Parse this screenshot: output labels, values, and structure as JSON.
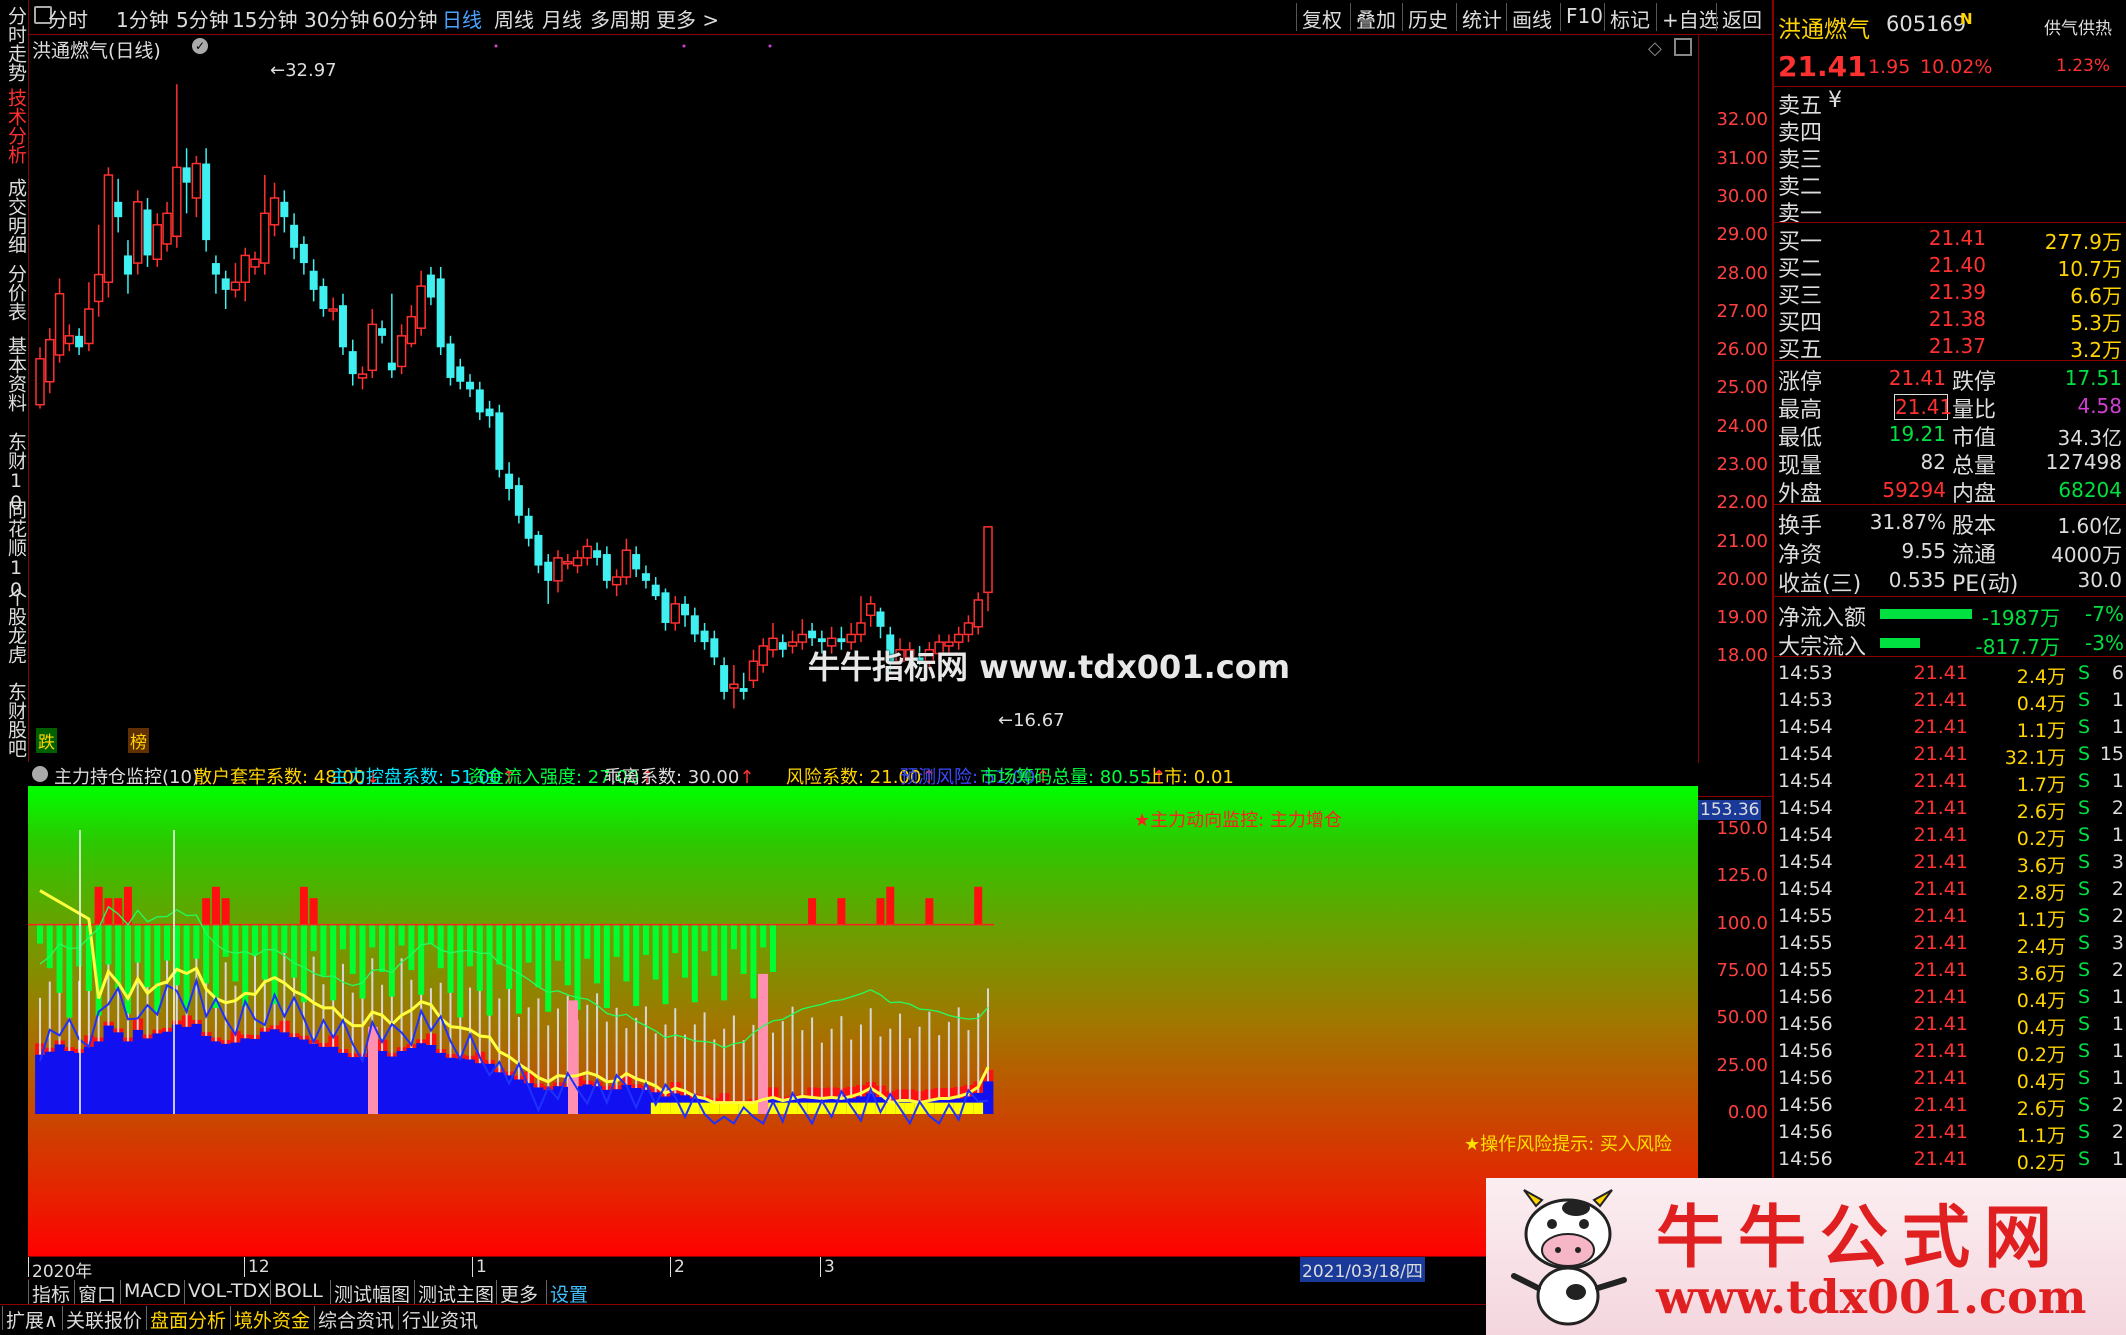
{
  "toolbar": {
    "periods": [
      "分时",
      "1分钟",
      "5分钟",
      "15分钟",
      "30分钟",
      "60分钟",
      "日线",
      "周线",
      "月线",
      "多周期",
      "更多 >"
    ],
    "selected": "日线",
    "right_buttons": [
      "复权",
      "叠加",
      "历史",
      "统计",
      "画线",
      "F10",
      "标记",
      "+自选",
      "返回"
    ]
  },
  "left_tabs": [
    "分时走势",
    "技术分析",
    "成交明细",
    "分价表",
    "基本资料",
    "东财10",
    "同花顺10",
    "个股龙虎",
    "东财股吧"
  ],
  "chart_title": "洪通燃气(日线)",
  "high_label": "32.97",
  "low_label": "16.67",
  "markers": {
    "die": "跌",
    "bang": "榜"
  },
  "y_axis_main": [
    "32.00",
    "31.00",
    "30.00",
    "29.00",
    "28.00",
    "27.00",
    "26.00",
    "25.00",
    "24.00",
    "23.00",
    "22.00",
    "21.00",
    "20.00",
    "19.00",
    "18.00"
  ],
  "y_axis_ind": [
    "150.0",
    "125.0",
    "100.0",
    "75.00",
    "50.00",
    "25.00",
    "0.00"
  ],
  "ind_top_value": "153.36",
  "indicator": {
    "name": "主力持仓监控(10)",
    "items": [
      {
        "text": "散户套牢系数: 48.00",
        "arrow": "↓",
        "color": "#ffd400"
      },
      {
        "text": "主力控盘系数: 51.00",
        "arrow": "↑",
        "color": "#00e5ff"
      },
      {
        "text": "资金流入强度: 27.00",
        "arrow": "↑",
        "color": "#00ff40"
      },
      {
        "text": "乖离系数: 30.00",
        "arrow": "↑",
        "color": "#dddddd"
      },
      {
        "text": "风险系数: 21.00",
        "arrow": "↑",
        "color": "#ffd400"
      },
      {
        "text": "预测风险: 51.00",
        "arrow": "↑",
        "color": "#3a4cff"
      },
      {
        "text": "市场筹码总量: 80.55",
        "arrow": "↑",
        "color": "#00ff40"
      },
      {
        "text": "上市: 0.01",
        "arrow": "",
        "color": "#ffd400"
      }
    ],
    "monitor_text": "★主力动向监控: 主力增仓",
    "risk_text": "★操作风险提示: 买入风险"
  },
  "time_axis": {
    "labels": [
      "2020年",
      "12",
      "1",
      "2",
      "3"
    ],
    "current": "2021/03/18/四"
  },
  "bottom_tabs": [
    "指标",
    "窗口",
    "MACD",
    "VOL-TDX",
    "BOLL",
    "测试幅图",
    "测试主图",
    "更多",
    "设置"
  ],
  "bottom_tabs2": [
    "扩展∧",
    "关联报价",
    "盘面分析",
    "境外资金",
    "综合资讯",
    "行业资讯"
  ],
  "watermark_center": "牛牛指标网 www.tdx001.com",
  "watermark_logo_title": "牛牛公式网",
  "watermark_logo_url": "www.tdx001.com",
  "quote": {
    "name": "洪通燃气",
    "code": "605169",
    "tag": "N",
    "sector": "供气供热",
    "price": "21.41",
    "change": "1.95",
    "pct": "10.02%",
    "sector_pct": "1.23%",
    "sell_labels": [
      "卖五",
      "卖四",
      "卖三",
      "卖二",
      "卖一"
    ],
    "sell_extra": "¥",
    "buy": [
      {
        "label": "买一",
        "price": "21.41",
        "vol": "277.9万"
      },
      {
        "label": "买二",
        "price": "21.40",
        "vol": "10.7万"
      },
      {
        "label": "买三",
        "price": "21.39",
        "vol": "6.6万"
      },
      {
        "label": "买四",
        "price": "21.38",
        "vol": "5.3万"
      },
      {
        "label": "买五",
        "price": "21.37",
        "vol": "3.2万"
      }
    ],
    "stats": [
      {
        "l": "涨停",
        "v": "21.41",
        "vc": "#ff3030",
        "l2": "跌停",
        "v2": "17.51",
        "v2c": "#00e040"
      },
      {
        "l": "最高",
        "v": "21.41",
        "vc": "#ff3030",
        "l2": "量比",
        "v2": "4.58",
        "v2c": "#d040d0"
      },
      {
        "l": "最低",
        "v": "19.21",
        "vc": "#00e040",
        "l2": "市值",
        "v2": "34.3亿",
        "v2c": "#dddddd"
      },
      {
        "l": "现量",
        "v": "82",
        "vc": "#dddddd",
        "l2": "总量",
        "v2": "127498",
        "v2c": "#dddddd"
      },
      {
        "l": "外盘",
        "v": "59294",
        "vc": "#ff3030",
        "l2": "内盘",
        "v2": "68204",
        "v2c": "#00e040"
      }
    ],
    "stats2": [
      {
        "l": "换手",
        "v": "31.87%",
        "l2": "股本",
        "v2": "1.60亿"
      },
      {
        "l": "净资",
        "v": "9.55",
        "l2": "流通",
        "v2": "4000万"
      },
      {
        "l": "收益(三)",
        "v": "0.535",
        "l2": "PE(动)",
        "v2": "30.0"
      }
    ],
    "flows": [
      {
        "l": "净流入额",
        "v": "-1987万",
        "p": "-7%"
      },
      {
        "l": "大宗流入",
        "v": "-817.7万",
        "p": "-3%"
      }
    ],
    "ticks": [
      [
        "14:53",
        "21.41",
        "2.4万",
        "S",
        "6"
      ],
      [
        "14:53",
        "21.41",
        "0.4万",
        "S",
        "1"
      ],
      [
        "14:54",
        "21.41",
        "1.1万",
        "S",
        "1"
      ],
      [
        "14:54",
        "21.41",
        "32.1万",
        "S",
        "15"
      ],
      [
        "14:54",
        "21.41",
        "1.7万",
        "S",
        "1"
      ],
      [
        "14:54",
        "21.41",
        "2.6万",
        "S",
        "2"
      ],
      [
        "14:54",
        "21.41",
        "0.2万",
        "S",
        "1"
      ],
      [
        "14:54",
        "21.41",
        "3.6万",
        "S",
        "3"
      ],
      [
        "14:54",
        "21.41",
        "2.8万",
        "S",
        "2"
      ],
      [
        "14:55",
        "21.41",
        "1.1万",
        "S",
        "2"
      ],
      [
        "14:55",
        "21.41",
        "2.4万",
        "S",
        "3"
      ],
      [
        "14:55",
        "21.41",
        "3.6万",
        "S",
        "2"
      ],
      [
        "14:56",
        "21.41",
        "0.4万",
        "S",
        "1"
      ],
      [
        "14:56",
        "21.41",
        "0.4万",
        "S",
        "1"
      ],
      [
        "14:56",
        "21.41",
        "0.2万",
        "S",
        "1"
      ],
      [
        "14:56",
        "21.41",
        "0.4万",
        "S",
        "1"
      ],
      [
        "14:56",
        "21.41",
        "2.6万",
        "S",
        "2"
      ],
      [
        "14:56",
        "21.41",
        "1.1万",
        "S",
        "2"
      ],
      [
        "14:56",
        "21.41",
        "0.2万",
        "S",
        "1"
      ]
    ]
  },
  "chart_data": {
    "type": "candlestick",
    "ylim": [
      16.0,
      33.5
    ],
    "candles": [
      {
        "o": 24.6,
        "c": 25.8,
        "h": 26.1,
        "l": 24.5
      },
      {
        "o": 25.2,
        "c": 26.3,
        "h": 26.6,
        "l": 24.9
      },
      {
        "o": 25.9,
        "c": 27.5,
        "h": 27.9,
        "l": 25.7
      },
      {
        "o": 26.2,
        "c": 26.4,
        "h": 26.7,
        "l": 26.0
      },
      {
        "o": 26.4,
        "c": 26.1,
        "h": 26.6,
        "l": 25.9
      },
      {
        "o": 26.2,
        "c": 27.1,
        "h": 27.8,
        "l": 26.0
      },
      {
        "o": 27.3,
        "c": 28.0,
        "h": 29.3,
        "l": 26.9
      },
      {
        "o": 27.8,
        "c": 30.6,
        "h": 30.8,
        "l": 27.4
      },
      {
        "o": 29.9,
        "c": 29.5,
        "h": 30.5,
        "l": 29.1
      },
      {
        "o": 28.5,
        "c": 28.0,
        "h": 28.9,
        "l": 27.5
      },
      {
        "o": 28.3,
        "c": 29.9,
        "h": 30.2,
        "l": 28.0
      },
      {
        "o": 29.7,
        "c": 28.5,
        "h": 30.0,
        "l": 28.2
      },
      {
        "o": 28.4,
        "c": 29.3,
        "h": 29.6,
        "l": 28.2
      },
      {
        "o": 28.8,
        "c": 29.6,
        "h": 29.9,
        "l": 28.6
      },
      {
        "o": 29.0,
        "c": 30.8,
        "h": 32.97,
        "l": 28.7
      },
      {
        "o": 30.8,
        "c": 30.4,
        "h": 31.3,
        "l": 29.6
      },
      {
        "o": 30.0,
        "c": 30.9,
        "h": 31.1,
        "l": 29.5
      },
      {
        "o": 30.9,
        "c": 28.9,
        "h": 31.3,
        "l": 28.6
      },
      {
        "o": 28.3,
        "c": 28.0,
        "h": 28.5,
        "l": 27.5
      },
      {
        "o": 27.9,
        "c": 27.6,
        "h": 28.1,
        "l": 27.1
      },
      {
        "o": 27.6,
        "c": 27.8,
        "h": 28.3,
        "l": 27.4
      },
      {
        "o": 27.8,
        "c": 28.5,
        "h": 28.7,
        "l": 27.3
      },
      {
        "o": 28.2,
        "c": 28.4,
        "h": 28.6,
        "l": 28.0
      },
      {
        "o": 28.3,
        "c": 29.6,
        "h": 30.6,
        "l": 28.0
      },
      {
        "o": 29.3,
        "c": 30.0,
        "h": 30.4,
        "l": 29.0
      },
      {
        "o": 29.9,
        "c": 29.5,
        "h": 30.2,
        "l": 29.1
      },
      {
        "o": 29.3,
        "c": 28.7,
        "h": 29.6,
        "l": 28.4
      },
      {
        "o": 28.8,
        "c": 28.3,
        "h": 29.0,
        "l": 28.0
      },
      {
        "o": 28.1,
        "c": 27.6,
        "h": 28.4,
        "l": 27.3
      },
      {
        "o": 27.7,
        "c": 27.1,
        "h": 27.9,
        "l": 26.9
      },
      {
        "o": 27.1,
        "c": 27.1,
        "h": 27.4,
        "l": 26.8
      },
      {
        "o": 27.2,
        "c": 26.1,
        "h": 27.5,
        "l": 25.9
      },
      {
        "o": 26.0,
        "c": 25.4,
        "h": 26.3,
        "l": 25.1
      },
      {
        "o": 25.3,
        "c": 25.4,
        "h": 25.6,
        "l": 25.0
      },
      {
        "o": 25.5,
        "c": 26.7,
        "h": 27.1,
        "l": 25.3
      },
      {
        "o": 26.6,
        "c": 26.4,
        "h": 26.8,
        "l": 26.2
      },
      {
        "o": 25.7,
        "c": 25.5,
        "h": 27.5,
        "l": 25.3
      },
      {
        "o": 25.6,
        "c": 26.4,
        "h": 26.7,
        "l": 25.4
      },
      {
        "o": 26.2,
        "c": 26.9,
        "h": 27.2,
        "l": 26.1
      },
      {
        "o": 26.6,
        "c": 27.7,
        "h": 28.1,
        "l": 26.4
      },
      {
        "o": 28.0,
        "c": 27.4,
        "h": 28.2,
        "l": 27.2
      },
      {
        "o": 27.9,
        "c": 26.1,
        "h": 28.2,
        "l": 25.9
      },
      {
        "o": 26.2,
        "c": 25.3,
        "h": 26.4,
        "l": 25.1
      },
      {
        "o": 25.6,
        "c": 25.2,
        "h": 25.8,
        "l": 25.0
      },
      {
        "o": 25.2,
        "c": 25.0,
        "h": 25.4,
        "l": 24.8
      },
      {
        "o": 25.0,
        "c": 24.4,
        "h": 25.2,
        "l": 24.2
      },
      {
        "o": 24.5,
        "c": 24.3,
        "h": 24.7,
        "l": 24.0
      },
      {
        "o": 24.4,
        "c": 22.9,
        "h": 24.6,
        "l": 22.7
      },
      {
        "o": 22.8,
        "c": 22.4,
        "h": 23.1,
        "l": 22.1
      },
      {
        "o": 22.5,
        "c": 21.7,
        "h": 22.7,
        "l": 21.5
      },
      {
        "o": 21.7,
        "c": 21.1,
        "h": 21.9,
        "l": 20.9
      },
      {
        "o": 21.2,
        "c": 20.4,
        "h": 21.3,
        "l": 20.2
      },
      {
        "o": 20.5,
        "c": 20.0,
        "h": 20.7,
        "l": 19.4
      },
      {
        "o": 20.0,
        "c": 20.6,
        "h": 20.8,
        "l": 19.7
      },
      {
        "o": 20.5,
        "c": 20.5,
        "h": 20.7,
        "l": 20.3
      },
      {
        "o": 20.4,
        "c": 20.6,
        "h": 20.8,
        "l": 20.2
      },
      {
        "o": 20.6,
        "c": 20.9,
        "h": 21.1,
        "l": 20.4
      },
      {
        "o": 20.8,
        "c": 20.6,
        "h": 21.0,
        "l": 20.4
      },
      {
        "o": 20.7,
        "c": 20.0,
        "h": 20.9,
        "l": 19.8
      },
      {
        "o": 19.9,
        "c": 20.1,
        "h": 20.3,
        "l": 19.6
      },
      {
        "o": 20.1,
        "c": 20.8,
        "h": 21.1,
        "l": 19.9
      },
      {
        "o": 20.7,
        "c": 20.3,
        "h": 20.9,
        "l": 20.1
      },
      {
        "o": 20.2,
        "c": 20.0,
        "h": 20.4,
        "l": 19.8
      },
      {
        "o": 19.9,
        "c": 19.6,
        "h": 20.1,
        "l": 19.5
      },
      {
        "o": 19.7,
        "c": 18.9,
        "h": 19.8,
        "l": 18.7
      },
      {
        "o": 18.9,
        "c": 19.4,
        "h": 19.6,
        "l": 18.7
      },
      {
        "o": 19.4,
        "c": 19.1,
        "h": 19.6,
        "l": 18.8
      },
      {
        "o": 19.1,
        "c": 18.6,
        "h": 19.3,
        "l": 18.4
      },
      {
        "o": 18.7,
        "c": 18.4,
        "h": 18.9,
        "l": 18.2
      },
      {
        "o": 18.5,
        "c": 18.0,
        "h": 18.7,
        "l": 17.8
      },
      {
        "o": 17.8,
        "c": 17.1,
        "h": 18.0,
        "l": 16.9
      },
      {
        "o": 17.2,
        "c": 17.3,
        "h": 17.8,
        "l": 16.67
      },
      {
        "o": 17.2,
        "c": 17.1,
        "h": 17.6,
        "l": 16.9
      },
      {
        "o": 17.4,
        "c": 17.9,
        "h": 18.2,
        "l": 17.2
      },
      {
        "o": 17.8,
        "c": 18.3,
        "h": 18.5,
        "l": 17.6
      },
      {
        "o": 18.2,
        "c": 18.5,
        "h": 18.9,
        "l": 18.0
      },
      {
        "o": 18.4,
        "c": 18.2,
        "h": 18.6,
        "l": 18.0
      },
      {
        "o": 18.3,
        "c": 18.4,
        "h": 18.7,
        "l": 18.1
      },
      {
        "o": 18.4,
        "c": 18.6,
        "h": 19.0,
        "l": 18.2
      },
      {
        "o": 18.7,
        "c": 18.5,
        "h": 18.9,
        "l": 18.3
      },
      {
        "o": 18.5,
        "c": 18.4,
        "h": 18.7,
        "l": 18.1
      },
      {
        "o": 18.3,
        "c": 18.5,
        "h": 18.8,
        "l": 18.1
      },
      {
        "o": 18.5,
        "c": 18.4,
        "h": 18.8,
        "l": 18.2
      },
      {
        "o": 18.4,
        "c": 18.6,
        "h": 18.9,
        "l": 18.2
      },
      {
        "o": 18.6,
        "c": 18.9,
        "h": 19.6,
        "l": 18.4
      },
      {
        "o": 19.1,
        "c": 19.4,
        "h": 19.6,
        "l": 18.8
      },
      {
        "o": 19.2,
        "c": 18.8,
        "h": 19.3,
        "l": 18.5
      },
      {
        "o": 18.6,
        "c": 17.9,
        "h": 18.8,
        "l": 17.6
      },
      {
        "o": 17.9,
        "c": 18.2,
        "h": 18.5,
        "l": 17.8
      },
      {
        "o": 18.0,
        "c": 18.2,
        "h": 18.4,
        "l": 17.9
      },
      {
        "o": 18.0,
        "c": 17.9,
        "h": 18.3,
        "l": 17.8
      },
      {
        "o": 17.9,
        "c": 18.2,
        "h": 18.4,
        "l": 17.7
      },
      {
        "o": 18.1,
        "c": 18.4,
        "h": 18.6,
        "l": 17.9
      },
      {
        "o": 18.3,
        "c": 18.4,
        "h": 18.6,
        "l": 18.1
      },
      {
        "o": 18.4,
        "c": 18.6,
        "h": 18.8,
        "l": 18.2
      },
      {
        "o": 18.6,
        "c": 18.9,
        "h": 19.1,
        "l": 18.4
      },
      {
        "o": 18.8,
        "c": 19.5,
        "h": 19.7,
        "l": 18.6
      },
      {
        "o": 19.7,
        "c": 21.41,
        "h": 21.41,
        "l": 19.21
      }
    ]
  }
}
